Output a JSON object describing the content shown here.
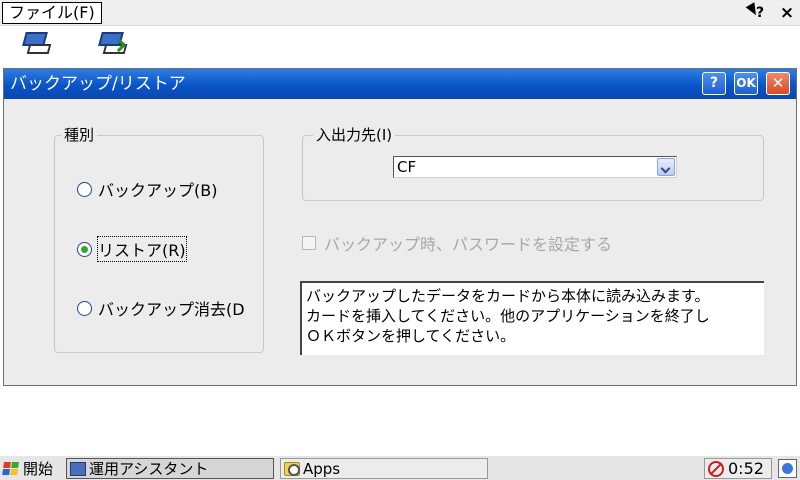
{
  "menubar": {
    "file_menu": "ファイル(F)",
    "help_pointer": "?",
    "close": "×"
  },
  "dialog": {
    "title": "バックアップ/リストア",
    "help_btn": "?",
    "ok_btn": "OK",
    "close_btn": "✕",
    "type_group": {
      "label": "種別",
      "options": [
        {
          "label": "バックアップ(B)",
          "checked": false
        },
        {
          "label": "リストア(R)",
          "checked": true
        },
        {
          "label": "バックアップ消去(D",
          "checked": false
        }
      ]
    },
    "io_group": {
      "label": "入出力先(I)",
      "selected": "CF"
    },
    "password_checkbox": {
      "label": "バックアップ時、パスワードを設定する",
      "checked": false,
      "enabled": false
    },
    "info_text": "バックアップしたデータをカードから本体に読み込みます。\nカードを挿入してください。他のアプリケーションを終了し\nＯＫボタンを押してください。"
  },
  "taskbar": {
    "start": "開始",
    "active_task": "運用アシスタント",
    "task2": "Apps",
    "clock": "0:52"
  }
}
